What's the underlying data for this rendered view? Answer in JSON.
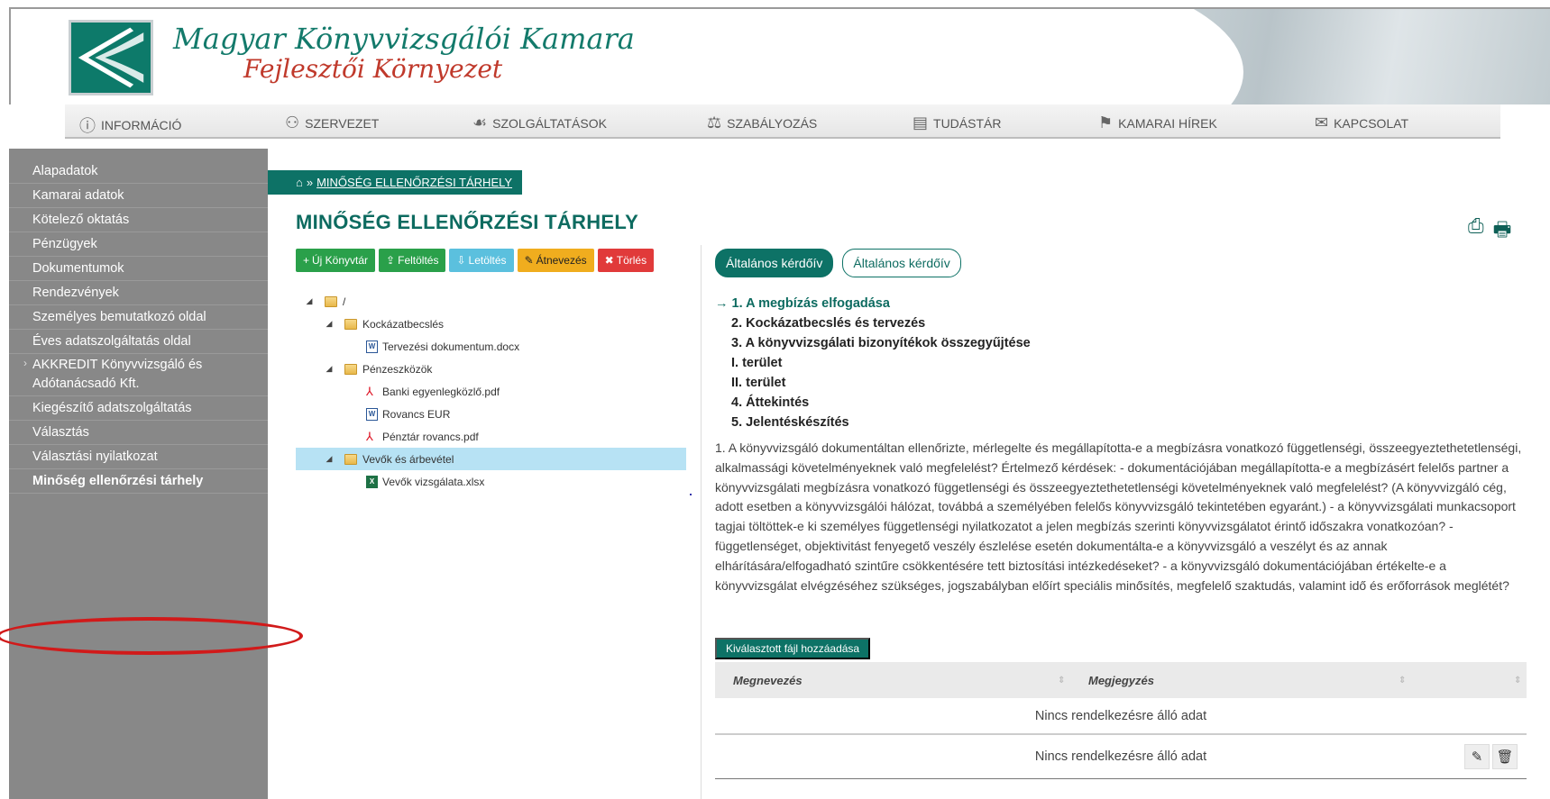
{
  "header": {
    "logo_line1": "Magyar Könyvvizsgálói Kamara",
    "logo_line2": "Fejlesztői Környezet"
  },
  "topnav": [
    {
      "label": "INFORMÁCIÓ",
      "icon": "info-icon"
    },
    {
      "label": "SZERVEZET",
      "icon": "org-icon"
    },
    {
      "label": "SZOLGÁLTATÁSOK",
      "icon": "hand-icon"
    },
    {
      "label": "SZABÁLYOZÁS",
      "icon": "gavel-icon"
    },
    {
      "label": "TUDÁSTÁR",
      "icon": "newspaper-icon"
    },
    {
      "label": "KAMARAI HÍREK",
      "icon": "news-flag-icon"
    },
    {
      "label": "KAPCSOLAT",
      "icon": "envelope-icon"
    }
  ],
  "sidebar": {
    "items": [
      "Alapadatok",
      "Kamarai adatok",
      "Kötelező oktatás",
      "Pénzügyek",
      "Dokumentumok",
      "Rendezvények",
      "Személyes bemutatkozó oldal",
      "Éves adatszolgáltatás oldal",
      "AKKREDIT Könyvvizsgáló és Adótanácsadó Kft.",
      "Kiegészítő adatszolgáltatás",
      "Választás",
      "Választási nyilatkozat",
      "Minőség ellenőrzési tárhely"
    ]
  },
  "breadcrumb": {
    "separator": "»",
    "current": "MINŐSÉG ELLENŐRZÉSI TÁRHELY"
  },
  "page_title": "MINŐSÉG ELLENŐRZÉSI TÁRHELY",
  "toolbar": {
    "new_library": "Új Könyvtár",
    "upload": "Feltöltés",
    "download": "Letöltés",
    "rename": "Átnevezés",
    "delete": "Törlés"
  },
  "tree": [
    {
      "label": "/",
      "type": "folder",
      "level": 0
    },
    {
      "label": "Kockázatbecslés",
      "type": "folder",
      "level": 1
    },
    {
      "label": "Tervezési dokumentum.docx",
      "type": "doc",
      "level": 2
    },
    {
      "label": "Pénzeszközök",
      "type": "folder",
      "level": 1
    },
    {
      "label": "Banki egyenlegközlő.pdf",
      "type": "pdf",
      "level": 2
    },
    {
      "label": "Rovancs EUR",
      "type": "doc",
      "level": 2
    },
    {
      "label": "Pénztár rovancs.pdf",
      "type": "pdf",
      "level": 2
    },
    {
      "label": "Vevők és árbevétel",
      "type": "folder",
      "level": 1
    },
    {
      "label": "Vevők vizsgálata.xlsx",
      "type": "xls",
      "level": 2
    }
  ],
  "tabs": {
    "active": "Általános kérdőív",
    "second": "Általános kérdőív"
  },
  "steps": [
    "1. A megbízás elfogadása",
    "2. Kockázatbecslés és tervezés",
    "3. A könyvvizsgálati bizonyítékok összegyűjtése",
    "I. terület",
    "II. terület",
    "4. Áttekintés",
    "5. Jelentéskészítés"
  ],
  "current_step_arrow": "→",
  "paragraph": "1. A könyvvizsgáló dokumentáltan ellenőrizte, mérlegelte és megállapította-e a megbízásra vonatkozó függetlenségi, összeegyeztethetetlenségi, alkalmassági követelményeknek való megfelelést? Értelmező kérdések: - dokumentációjában megállapította-e a megbízásért felelős partner a könyvvizsgálati megbízásra vonatkozó függetlenségi és összeegyeztethetetlenségi követelményeknek való megfelelést? (A könyvvizgáló cég, adott esetben a könyvvizsgálói hálózat, továbbá a személyében felelős könyvvizsgáló tekintetében egyaránt.) - a könyvvizsgálati munkacsoport tagjai töltöttek-e ki személyes függetlenségi nyilatkozatot a jelen megbízás szerinti könyvvizsgálatot érintő időszakra vonatkozóan? - függetlenséget, objektivitást fenyegető veszély észlelése esetén dokumentálta-e a könyvvizsgáló a veszélyt és az annak elhárítására/elfogadható szintűre csökkentésére tett biztosítási intézkedéseket? - a könyvvizsgáló dokumentációjában értékelte-e a könyvvizsgálat elvégzéséhez szükséges, jogszabályban előírt speciális minősítés, megfelelő szaktudás, valamint idő és erőforrások meglétét?",
  "add_file_button": "Kiválasztott fájl hozzáadása",
  "table": {
    "col1": "Megnevezés",
    "col2": "Megjegyzés",
    "empty1": "Nincs rendelkezésre álló adat",
    "empty2": "Nincs rendelkezésre álló adat"
  },
  "colors": {
    "brand_green": "#0d7266",
    "sidebar_gray": "#888888",
    "highlight_red": "#d11a1a"
  }
}
